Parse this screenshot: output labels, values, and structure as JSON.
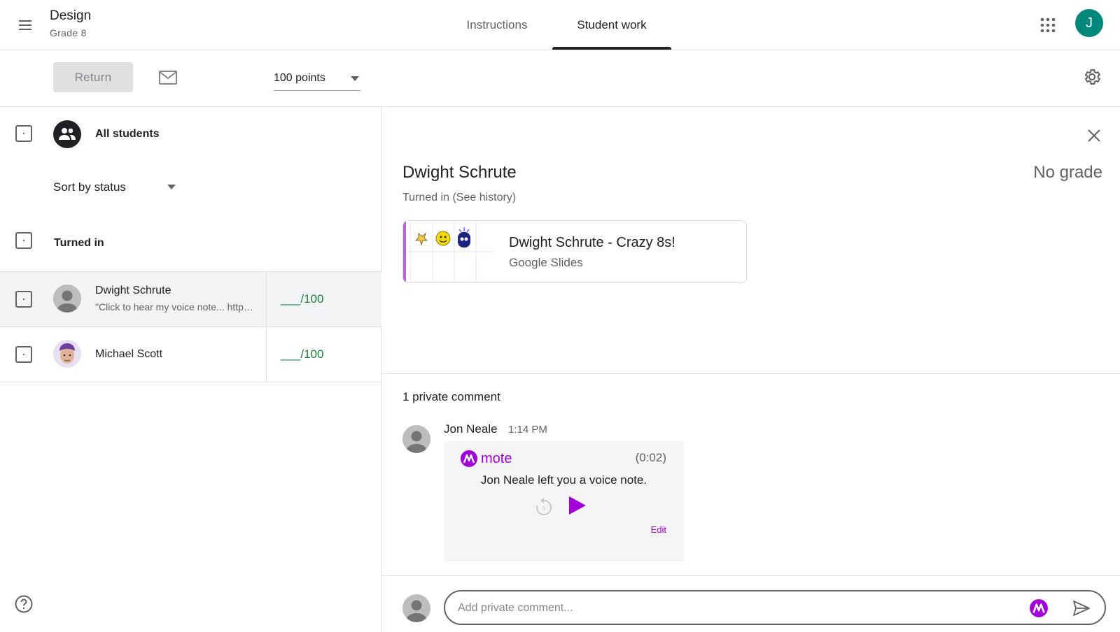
{
  "header": {
    "class_title": "Design",
    "class_subtitle": "Grade 8",
    "tabs": [
      {
        "label": "Instructions",
        "active": false
      },
      {
        "label": "Student work",
        "active": true
      }
    ],
    "user_initial": "J",
    "avatar_color": "#00897b"
  },
  "toolbar": {
    "return_label": "Return",
    "points_value": "100 points"
  },
  "roster": {
    "all_students_label": "All students",
    "sort_label": "Sort by status",
    "section_label": "Turned in",
    "students": [
      {
        "name": "Dwight Schrute",
        "snippet": "\"Click to hear my voice note... https://mote.fm/xyz",
        "grade": "___/100",
        "selected": true
      },
      {
        "name": "Michael Scott",
        "snippet": "",
        "grade": "___/100",
        "selected": false
      }
    ],
    "grade_color": "#188038"
  },
  "detail": {
    "student_name": "Dwight Schrute",
    "grade_status": "No grade",
    "status_text": "Turned in",
    "history_link": "(See history)",
    "attachment": {
      "title": "Dwight Schrute - Crazy 8s!",
      "type": "Google Slides"
    }
  },
  "comments": {
    "heading": "1 private comment",
    "items": [
      {
        "author": "Jon Neale",
        "time": "1:14 PM",
        "mote": {
          "brand": "mote",
          "duration": "(0:02)",
          "message": "Jon Neale left you a voice note.",
          "edit_label": "Edit",
          "brand_color": "#a100d6"
        }
      }
    ],
    "compose_placeholder": "Add private comment..."
  }
}
